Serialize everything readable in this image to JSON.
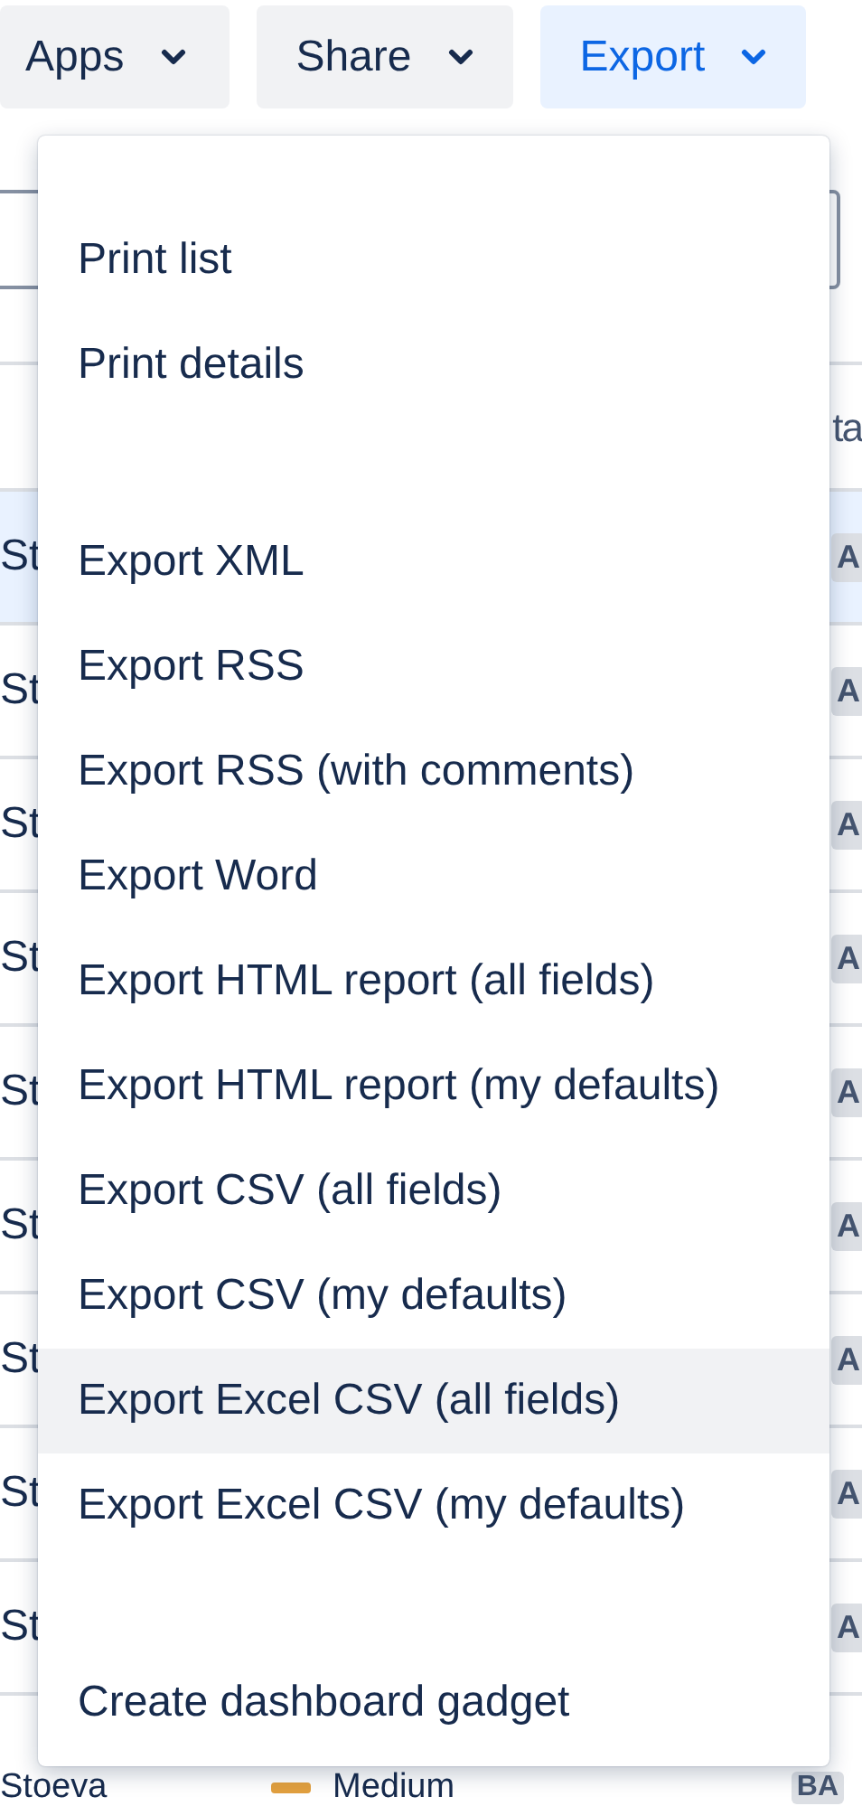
{
  "toolbar": {
    "buttons": [
      {
        "label": "Apps",
        "selected": false
      },
      {
        "label": "Share",
        "selected": false
      },
      {
        "label": "Export",
        "selected": true
      }
    ]
  },
  "table": {
    "header": {
      "column_last": "ta"
    },
    "rows": [
      {
        "selected": true,
        "column_1": "St",
        "column_last": "A"
      },
      {
        "selected": false,
        "column_1": "St",
        "column_last": "A"
      },
      {
        "selected": false,
        "column_1": "St",
        "column_last": "A"
      },
      {
        "selected": false,
        "column_1": "St",
        "column_last": "A"
      },
      {
        "selected": false,
        "column_1": "St",
        "column_last": "A"
      },
      {
        "selected": false,
        "column_1": "St",
        "column_last": "A"
      },
      {
        "selected": false,
        "column_1": "St",
        "column_last": "A"
      },
      {
        "selected": false,
        "column_1": "St",
        "column_last": "A"
      },
      {
        "selected": false,
        "column_1": "St",
        "column_last": "A"
      },
      {
        "selected": false,
        "column_1": "Stoeva",
        "priority": "Medium",
        "column_last": "BA"
      }
    ]
  },
  "export_menu": {
    "groups": [
      {
        "items": [
          {
            "label": "Print list",
            "hovered": false
          },
          {
            "label": "Print details",
            "hovered": false
          }
        ]
      },
      {
        "items": [
          {
            "label": "Export XML",
            "hovered": false
          },
          {
            "label": "Export RSS",
            "hovered": false
          },
          {
            "label": "Export RSS (with comments)",
            "hovered": false
          },
          {
            "label": "Export Word",
            "hovered": false
          },
          {
            "label": "Export HTML report (all fields)",
            "hovered": false
          },
          {
            "label": "Export HTML report (my defaults)",
            "hovered": false
          },
          {
            "label": "Export CSV (all fields)",
            "hovered": false
          },
          {
            "label": "Export CSV (my defaults)",
            "hovered": false
          },
          {
            "label": "Export Excel CSV (all fields)",
            "hovered": true
          },
          {
            "label": "Export Excel CSV (my defaults)",
            "hovered": false
          }
        ]
      },
      {
        "items": [
          {
            "label": "Create dashboard gadget",
            "hovered": false
          }
        ]
      }
    ]
  }
}
